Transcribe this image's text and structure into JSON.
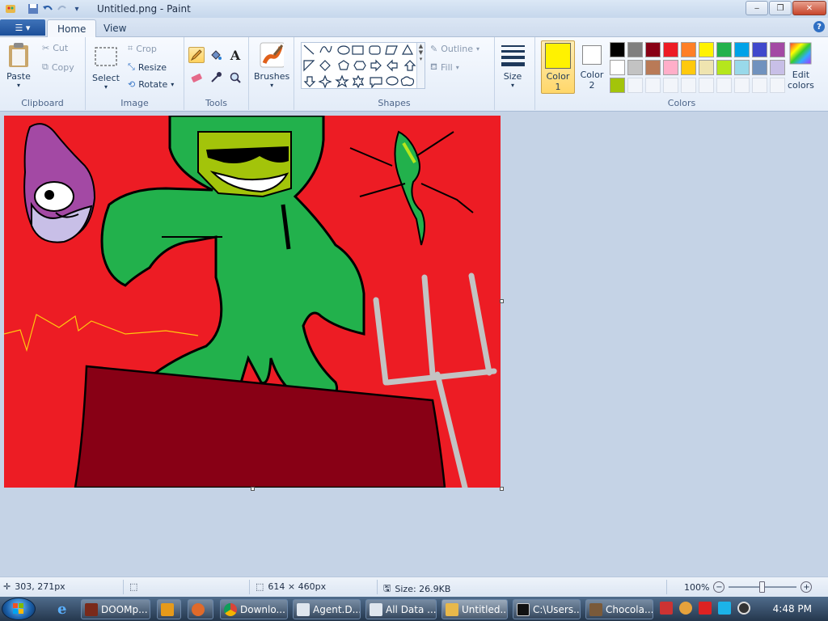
{
  "window": {
    "title": "Untitled.png - Paint"
  },
  "tabs": {
    "home": "Home",
    "view": "View"
  },
  "clipboard": {
    "paste": "Paste",
    "cut": "Cut",
    "copy": "Copy",
    "label": "Clipboard"
  },
  "image": {
    "select": "Select",
    "crop": "Crop",
    "resize": "Resize",
    "rotate": "Rotate",
    "label": "Image"
  },
  "tools": {
    "label": "Tools",
    "brushes": "Brushes"
  },
  "shapes": {
    "outline": "Outline",
    "fill": "Fill",
    "label": "Shapes"
  },
  "size": {
    "label": "Size"
  },
  "colors": {
    "color1_label": "Color",
    "color1_num": "1",
    "color2_label": "Color",
    "color2_num": "2",
    "edit": "Edit",
    "edit2": "colors",
    "label": "Colors",
    "color1": "#fff200",
    "color2": "#ffffff",
    "palette": [
      "#000000",
      "#7f7f7f",
      "#880015",
      "#ed1c24",
      "#ff7f27",
      "#fff200",
      "#22b14c",
      "#00a2e8",
      "#3f48cc",
      "#a349a4",
      "#ffffff",
      "#c3c3c3",
      "#b97a57",
      "#ffaec9",
      "#ffc90e",
      "#efe4b0",
      "#b5e61d",
      "#99d9ea",
      "#7092be",
      "#c8bfe7",
      "#a3c40a"
    ]
  },
  "status": {
    "cursor": "303, 271px",
    "dimensions": "614 × 460px",
    "size": "Size: 26.9KB",
    "zoom": "100%"
  },
  "taskbar": {
    "items": [
      "DOOMp...",
      "",
      "",
      "Downlo...",
      "Agent.D...",
      "All Data ...",
      "Untitled....",
      "C:\\Users...",
      "Chocola..."
    ],
    "clock": "4:48 PM"
  }
}
